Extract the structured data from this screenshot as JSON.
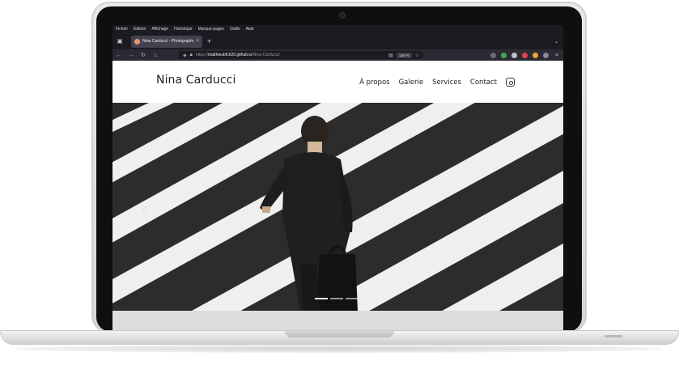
{
  "browser": {
    "menu": [
      "Fichier",
      "Édition",
      "Affichage",
      "Historique",
      "Marque-pages",
      "Outils",
      "Aide"
    ],
    "tab_title": "Nina Carducci - Photographe...",
    "tab_close": "×",
    "new_tab": "+",
    "url_prefix": "https://",
    "url_host": "matthieubfc620.github.io",
    "url_path": "/Nina-Carducci/",
    "zoom": "130 %"
  },
  "site": {
    "title": "Nina Carducci",
    "nav": [
      "À propos",
      "Galerie",
      "Services",
      "Contact"
    ]
  },
  "carousel": {
    "prev_label": "‹",
    "slide_count": 3,
    "active_slide": 1
  },
  "colors": {
    "chrome_dark": "#1c1b22",
    "toolbar": "#2b2a33",
    "tab_active": "#42414d"
  }
}
